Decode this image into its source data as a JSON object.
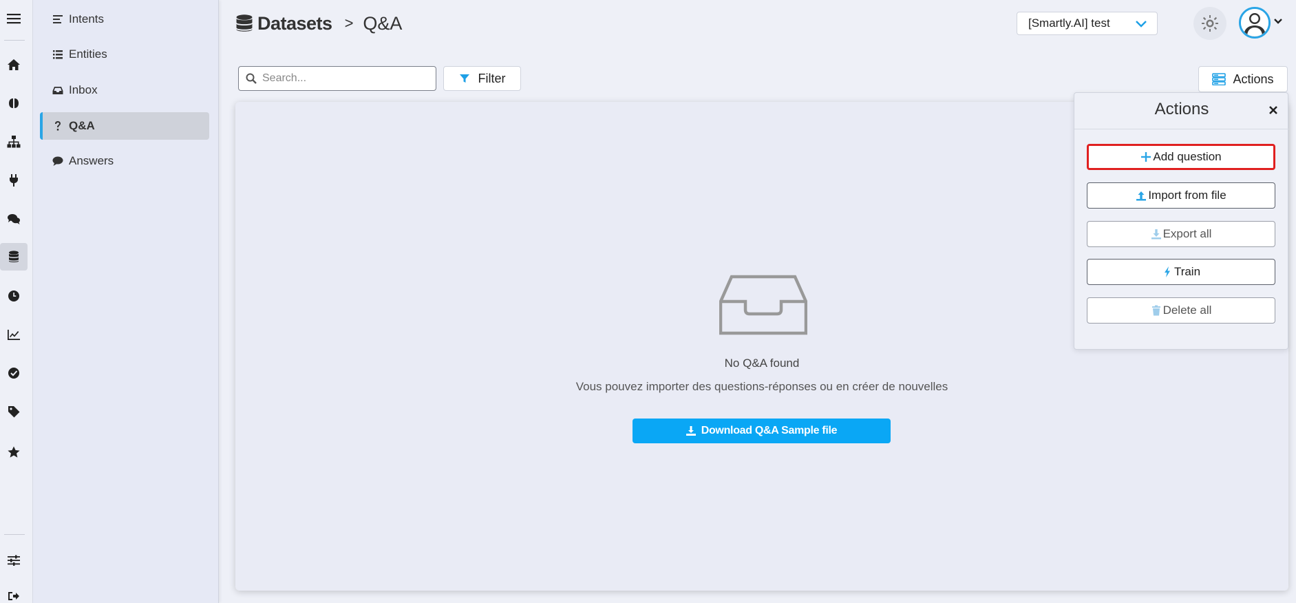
{
  "rail": {
    "icons": [
      "menu-icon",
      "home-icon",
      "brain-icon",
      "sitemap-icon",
      "plug-icon",
      "comments-icon",
      "database-icon",
      "clock-icon",
      "chart-line-icon",
      "check-circle-icon",
      "tag-icon",
      "star-icon",
      "sliders-icon",
      "sign-out-icon"
    ],
    "active": "database-icon"
  },
  "sidebar": {
    "items": [
      {
        "label": "Intents",
        "icon": "align-left-icon"
      },
      {
        "label": "Entities",
        "icon": "list-icon"
      },
      {
        "label": "Inbox",
        "icon": "inbox-icon"
      },
      {
        "label": "Q&A",
        "icon": "question-icon"
      },
      {
        "label": "Answers",
        "icon": "comment-icon"
      }
    ],
    "active": "Q&A"
  },
  "header": {
    "breadcrumb_root": "Datasets",
    "breadcrumb_sep": ">",
    "breadcrumb_current": "Q&A",
    "bot_select_value": "[Smartly.AI] test"
  },
  "toolbar": {
    "search_placeholder": "Search...",
    "filter_label": "Filter",
    "actions_label": "Actions"
  },
  "empty_state": {
    "title": "No Q&A found",
    "subtitle": "Vous pouvez importer des questions-réponses ou en créer de nouvelles",
    "download_label": "Download Q&A Sample file"
  },
  "actions_panel": {
    "title": "Actions",
    "buttons": [
      {
        "label": "Add question",
        "icon": "plus-icon",
        "state": "highlighted"
      },
      {
        "label": "Import from file",
        "icon": "upload-icon",
        "state": "enabled"
      },
      {
        "label": "Export all",
        "icon": "download-icon",
        "state": "disabled"
      },
      {
        "label": "Train",
        "icon": "bolt-icon",
        "state": "enabled"
      },
      {
        "label": "Delete all",
        "icon": "trash-icon",
        "state": "disabled"
      }
    ]
  },
  "colors": {
    "accent": "#0aa7f5",
    "highlight": "#e02020",
    "background": "#eef0f7"
  }
}
